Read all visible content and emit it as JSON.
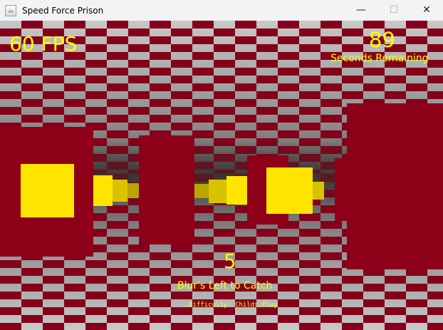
{
  "window": {
    "title": "Speed Force Prison",
    "minimize": "—",
    "maximize": "☐",
    "close": "✕"
  },
  "hud": {
    "fps": "60 FPS",
    "seconds": "89",
    "seconds_label": "Seconds Remaining",
    "blurs": "5",
    "blurs_label": "Blur's Left to Catch",
    "difficulty": "Difficulty: Childs Play"
  },
  "colors": {
    "wall": "#8e0018",
    "target": "#ffe400",
    "hud_text": "#ffff00"
  }
}
